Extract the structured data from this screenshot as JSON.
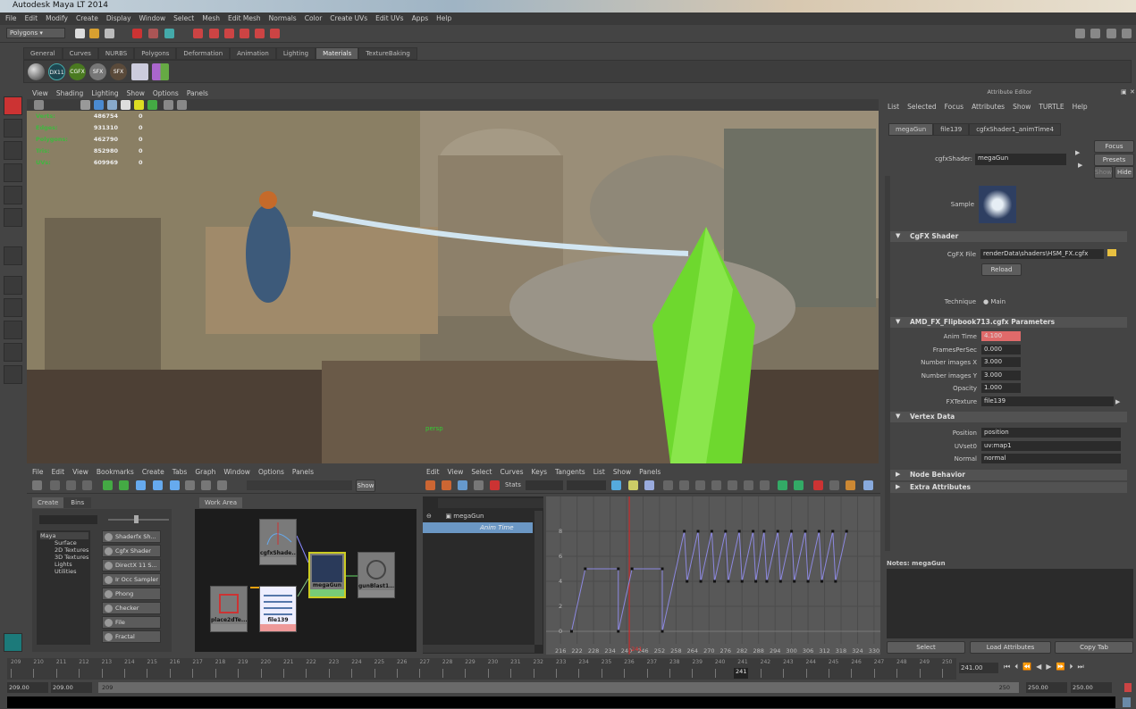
{
  "window": {
    "title": "Autodesk Maya LT 2014"
  },
  "menubar": [
    "File",
    "Edit",
    "Modify",
    "Create",
    "Display",
    "Window",
    "Select",
    "Mesh",
    "Edit Mesh",
    "Normals",
    "Color",
    "Create UVs",
    "Edit UVs",
    "Apps",
    "Help"
  ],
  "status_line": {
    "menu_set": "Polygons"
  },
  "shelf": {
    "tabs": [
      "General",
      "Curves",
      "NURBS",
      "Polygons",
      "Deformation",
      "Animation",
      "Lighting",
      "Materials",
      "TextureBaking"
    ],
    "active_tab": "Materials",
    "icons": [
      "",
      "DX11",
      "CGFX",
      "SFX",
      "SFX",
      "",
      ""
    ]
  },
  "viewport": {
    "menu": [
      "View",
      "Shading",
      "Lighting",
      "Show",
      "Options",
      "Panels"
    ],
    "hud": [
      {
        "label": "Verts:",
        "value": "486754",
        "sel": "0"
      },
      {
        "label": "Edges:",
        "value": "931310",
        "sel": "0"
      },
      {
        "label": "Polygons:",
        "value": "462790",
        "sel": "0"
      },
      {
        "label": "Tris:",
        "value": "852980",
        "sel": "0"
      },
      {
        "label": "UVs:",
        "value": "609969",
        "sel": "0"
      }
    ],
    "camera_label": "persp"
  },
  "hypershade": {
    "menu": [
      "File",
      "Edit",
      "View",
      "Bookmarks",
      "Create",
      "Tabs",
      "Graph",
      "Window",
      "Options",
      "Panels"
    ],
    "show_button": "Show",
    "left_tabs": [
      "Create",
      "Bins"
    ],
    "tree": [
      "Maya",
      "Surface",
      "2D Textures",
      "3D Textures",
      "Lights",
      "Utilities"
    ],
    "library": [
      "Shaderfx Sh...",
      "Cgfx Shader",
      "DirectX 11 S...",
      "Ir Occ Sampler",
      "Phong",
      "Checker",
      "File",
      "Fractal"
    ],
    "work_tab": "Work Area",
    "nodes": {
      "cgfx": "cgfxShade...",
      "mega": "megaGun",
      "blast": "gunBlast1...",
      "place": "place2dTe...",
      "file": "file139"
    }
  },
  "graph_editor": {
    "menu": [
      "Edit",
      "View",
      "Select",
      "Curves",
      "Keys",
      "Tangents",
      "List",
      "Show",
      "Panels"
    ],
    "stats_label": "Stats",
    "outliner": {
      "object": "megaGun",
      "attribute": "Anim Time"
    },
    "current_frame": "241",
    "curve_color": "#8c88e0",
    "chart_data": {
      "type": "line",
      "x_ticks": [
        216,
        222,
        228,
        234,
        240,
        246,
        252,
        258,
        264,
        270,
        276,
        282,
        288,
        294,
        300,
        306,
        312,
        318,
        324,
        330
      ],
      "y_ticks": [
        0,
        2,
        4,
        6,
        8
      ],
      "xlim": [
        214,
        331
      ],
      "ylim": [
        -1,
        10.5
      ],
      "keys": [
        [
          220,
          0
        ],
        [
          225,
          5
        ],
        [
          237,
          5
        ],
        [
          237,
          0
        ],
        [
          242,
          5
        ],
        [
          253,
          5
        ],
        [
          253,
          0
        ],
        [
          261,
          8
        ],
        [
          262,
          4
        ],
        [
          266,
          8
        ],
        [
          267,
          4
        ],
        [
          271,
          8
        ],
        [
          272,
          4
        ],
        [
          276,
          8
        ],
        [
          277,
          4
        ],
        [
          281,
          8
        ],
        [
          282,
          4
        ],
        [
          286,
          8
        ],
        [
          287,
          4
        ],
        [
          290,
          8
        ],
        [
          291,
          4
        ],
        [
          295,
          8
        ],
        [
          296,
          4
        ],
        [
          300,
          8
        ],
        [
          301,
          4
        ],
        [
          305,
          8
        ],
        [
          306,
          4
        ],
        [
          310,
          8
        ],
        [
          311,
          4
        ],
        [
          315,
          8
        ],
        [
          316,
          4
        ],
        [
          320,
          8
        ]
      ]
    }
  },
  "attribute_editor": {
    "title": "Attribute Editor",
    "menu": [
      "List",
      "Selected",
      "Focus",
      "Attributes",
      "Show",
      "TURTLE",
      "Help"
    ],
    "tabs": [
      "megaGun",
      "file139",
      "cgfxShader1_animTime4"
    ],
    "node_type_label": "cgfxShader:",
    "node_name": "megaGun",
    "buttons": {
      "focus": "Focus",
      "presets": "Presets",
      "show": "Show",
      "hide": "Hide",
      "reload": "Reload",
      "select": "Select",
      "load": "Load Attributes",
      "copy": "Copy Tab"
    },
    "sample_label": "Sample",
    "cgfx_section": "CgFX Shader",
    "cgfx_file_label": "CgFX File",
    "cgfx_file": "renderData\\shaders\\HSM_FX.cgfx",
    "technique_label": "Technique",
    "technique": "Main",
    "params_section": "AMD_FX_Flipbook713.cgfx Parameters",
    "params": [
      {
        "label": "Anim Time",
        "value": "4.100"
      },
      {
        "label": "FramesPerSec",
        "value": "0.000"
      },
      {
        "label": "Number images X",
        "value": "3.000"
      },
      {
        "label": "Number images Y",
        "value": "3.000"
      },
      {
        "label": "Opacity",
        "value": "1.000"
      },
      {
        "label": "FXTexture",
        "value": "file139"
      }
    ],
    "keyed_color": "#e06a6a",
    "vertex_section": "Vertex Data",
    "vertex": [
      {
        "label": "Position",
        "value": "position"
      },
      {
        "label": "UVset0",
        "value": "uv:map1"
      },
      {
        "label": "Normal",
        "value": "normal"
      }
    ],
    "collapsed": [
      "Node Behavior",
      "Extra Attributes"
    ],
    "notes_label": "Notes:  megaGun"
  },
  "time_slider": {
    "start": 209,
    "end": 250,
    "current": "241",
    "current_field": "241.00"
  },
  "range_slider": {
    "start_outer": "209.00",
    "start_inner": "209.00",
    "bar_start": "209",
    "bar_end": "250",
    "end_inner": "250.00",
    "end_outer": "250.00"
  }
}
